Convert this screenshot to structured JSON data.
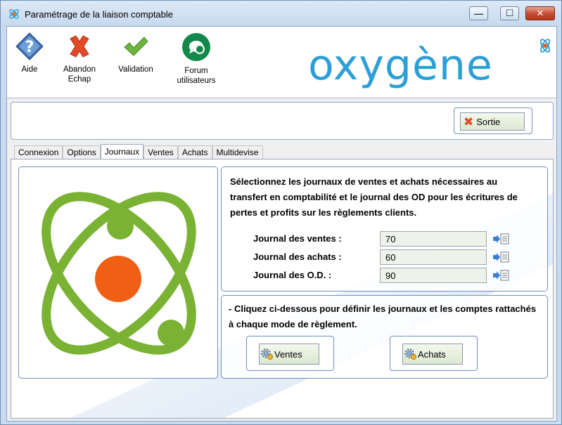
{
  "window": {
    "title": "Paramétrage de la liaison comptable",
    "min_glyph": "—",
    "max_glyph": "☐",
    "close_glyph": "✕"
  },
  "toolbar": {
    "aide": "Aide",
    "abandon_line1": "Abandon",
    "abandon_line2": "Echap",
    "validation": "Validation",
    "forum_line1": "Forum",
    "forum_line2": "utilisateurs"
  },
  "logo": {
    "text": "oxygène"
  },
  "header": {
    "sortie_label": "Sortie"
  },
  "tabs": [
    {
      "label": "Connexion",
      "active": false
    },
    {
      "label": "Options",
      "active": false
    },
    {
      "label": "Journaux",
      "active": true
    },
    {
      "label": "Ventes",
      "active": false
    },
    {
      "label": "Achats",
      "active": false
    },
    {
      "label": "Multidevise",
      "active": false
    }
  ],
  "journaux": {
    "description": "Sélectionnez les journaux de ventes et achats nécessaires au transfert en comptabilité et le journal des OD pour les écritures de pertes et profits sur les règlements clients.",
    "ventes": {
      "label": "Journal des ventes :",
      "value": "70"
    },
    "achats": {
      "label": "Journal des achats :",
      "value": "60"
    },
    "od": {
      "label": "Journal des O.D.  :",
      "value": "90"
    }
  },
  "modes": {
    "description": "- Cliquez ci-dessous pour définir les journaux et les comptes rattachés à chaque mode de règlement.",
    "ventes_label": "Ventes",
    "achats_label": "Achats"
  },
  "colors": {
    "brand_blue": "#2c9fd6",
    "atom_green": "#7ab233",
    "atom_core": "#f06014",
    "abandon_red": "#e04a26",
    "validation_green": "#6cb43f"
  },
  "icons": {
    "aide": "help-diamond-icon",
    "abandon": "red-x-icon",
    "validation": "green-check-icon",
    "forum": "forum-bubble-icon",
    "picker": "list-picker-icon",
    "mode": "gear-icon"
  }
}
